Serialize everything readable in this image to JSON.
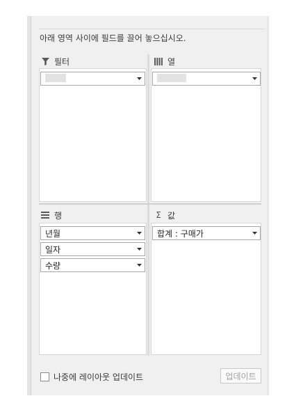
{
  "instruction": "아래 영역 사이에 필드를 끌어 놓으십시오.",
  "areas": {
    "filter": {
      "label": "필터",
      "icon": "filter-icon"
    },
    "columns": {
      "label": "열",
      "icon": "columns-icon"
    },
    "rows": {
      "label": "행",
      "icon": "rows-icon",
      "fields": [
        "년월",
        "일자",
        "수량"
      ]
    },
    "values": {
      "label": "값",
      "icon": "sigma-icon",
      "icon_glyph": "Σ",
      "fields": [
        "합계 : 구매가"
      ]
    }
  },
  "defer_update": {
    "label": "나중에 레이아웃 업데이트",
    "checked": false
  },
  "update_button": {
    "label": "업데이트",
    "enabled": false
  }
}
